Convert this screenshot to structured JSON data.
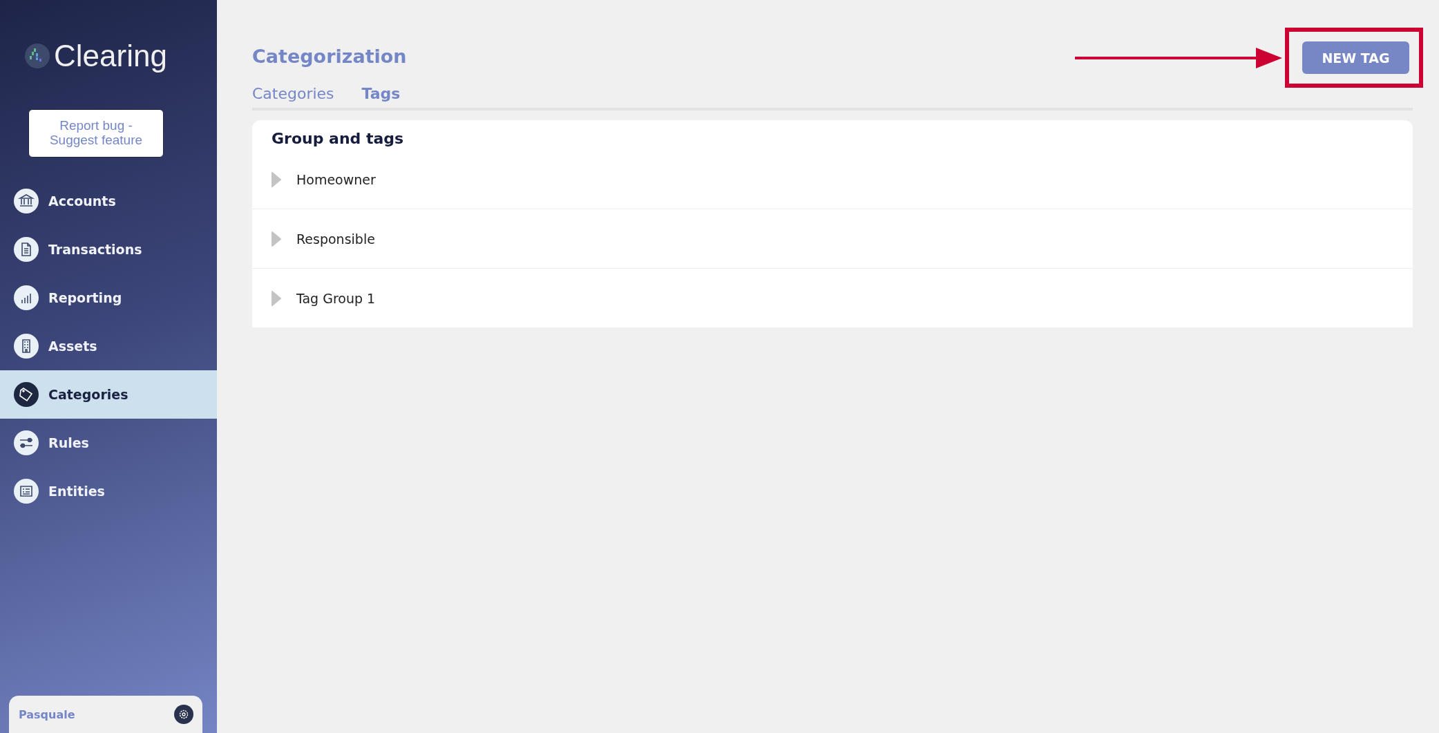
{
  "sidebar": {
    "logo": "Clearing",
    "report_button": "Report bug - Suggest feature",
    "items": [
      {
        "label": "Accounts",
        "kind": "bank",
        "selected": false
      },
      {
        "label": "Transactions",
        "kind": "document",
        "selected": false
      },
      {
        "label": "Reporting",
        "kind": "bars",
        "selected": false
      },
      {
        "label": "Assets",
        "kind": "building",
        "selected": false
      },
      {
        "label": "Categories",
        "kind": "tag",
        "selected": true
      },
      {
        "label": "Rules",
        "kind": "sliders",
        "selected": false
      },
      {
        "label": "Entities",
        "kind": "card",
        "selected": false
      }
    ],
    "user": "Pasquale"
  },
  "page": {
    "title": "Categorization",
    "new_button": "NEW TAG",
    "tabs": [
      {
        "label": "Categories",
        "selected": false
      },
      {
        "label": "Tags",
        "selected": true
      }
    ],
    "card_title": "Group and tags",
    "groups": [
      {
        "name": "Homeowner",
        "expanded": false
      },
      {
        "name": "Responsible",
        "expanded": false
      },
      {
        "name": "Tag Group 1",
        "expanded": false
      }
    ]
  }
}
